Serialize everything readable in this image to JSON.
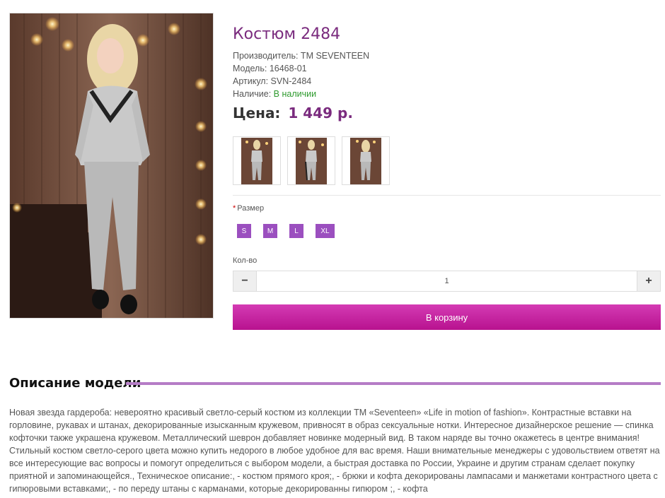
{
  "product": {
    "title": "Костюм 2484",
    "manufacturer": "Производитель: ТМ SEVENTEEN",
    "model": "Модель: 16468-01",
    "sku": "Артикул: SVN-2484",
    "availability_label": "Наличие: ",
    "availability_value": "В наличии",
    "price_label": "Цена:",
    "price_value": "1 449 р."
  },
  "size": {
    "required_mark": "*",
    "label": "Размер",
    "options": [
      "S",
      "M",
      "L",
      "XL"
    ]
  },
  "quantity": {
    "label": "Кол-во",
    "value": "1",
    "minus": "−",
    "plus": "+"
  },
  "cart_button": "В корзину",
  "description": {
    "heading": "Описание модели",
    "text": "Новая звезда гардероба: невероятно красивый светло-серый костюм из коллекции ТМ «Seventeen» «Life in motion of fashion». Контрастные вставки на горловине, рукавах и штанах, декорированные изысканным кружевом, привносят в образ сексуальные нотки. Интересное дизайнерское решение — спинка кофточки также украшена кружевом. Металлический шеврон добавляет новинке модерный вид. В таком наряде вы точно окажетесь в центре внимания! Стильный костюм светло-серого цвета можно купить недорого в любое удобное для вас время. Наши внимательные менеджеры с удовольствием ответят на все интересующие вас вопросы и помогут определиться с выбором модели, а быстрая доставка по России, Украине и другим странам сделает покупку приятной и запоминающейся., Техническое описание:, - костюм прямого кроя;, - брюки и кофта декорированы лампасами и манжетами контрастного цвета с гипюровыми вставками;, - по переду штаны с карманами, которые декорированны гипюром ;, - кофта"
  },
  "colors": {
    "accent": "#7a2b7e",
    "button_purple": "#9b4fbf",
    "cart_gradient_top": "#d43bb4",
    "cart_gradient_bottom": "#b8128f",
    "in_stock": "#2e9a2e"
  }
}
